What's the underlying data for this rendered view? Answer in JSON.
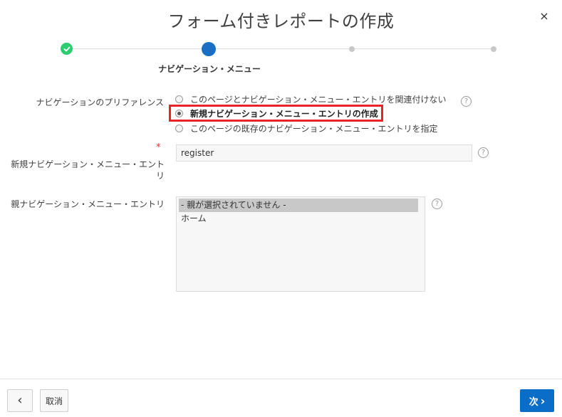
{
  "dialog": {
    "title": "フォーム付きレポートの作成",
    "close_glyph": "×"
  },
  "wizard": {
    "current_step_label": "ナビゲーション・メニュー",
    "steps_total": 4,
    "current_step": 2
  },
  "form": {
    "nav_preference": {
      "label": "ナビゲーションのプリファレンス",
      "options": [
        {
          "label": "このページとナビゲーション・メニュー・エントリを関連付けない",
          "selected": false
        },
        {
          "label": "新規ナビゲーション・メニュー・エントリの作成",
          "selected": true
        },
        {
          "label": "このページの既存のナビゲーション・メニュー・エントリを指定",
          "selected": false
        }
      ]
    },
    "new_entry": {
      "required_mark": "*",
      "label": "新規ナビゲーション・メニュー・エント リ",
      "value": "register"
    },
    "parent_entry": {
      "label": "親ナビゲーション・メニュー・エントリ",
      "options": [
        {
          "label": "- 親が選択されていません -",
          "selected": true
        },
        {
          "label": "ホーム",
          "selected": false
        }
      ]
    },
    "help_glyph": "?"
  },
  "footer": {
    "back_glyph": "‹",
    "cancel_label": "取消",
    "next_label": "次",
    "next_glyph": "›"
  },
  "colors": {
    "accent": "#0a6ec9",
    "done": "#2ecc71",
    "highlight": "#e8232a"
  }
}
